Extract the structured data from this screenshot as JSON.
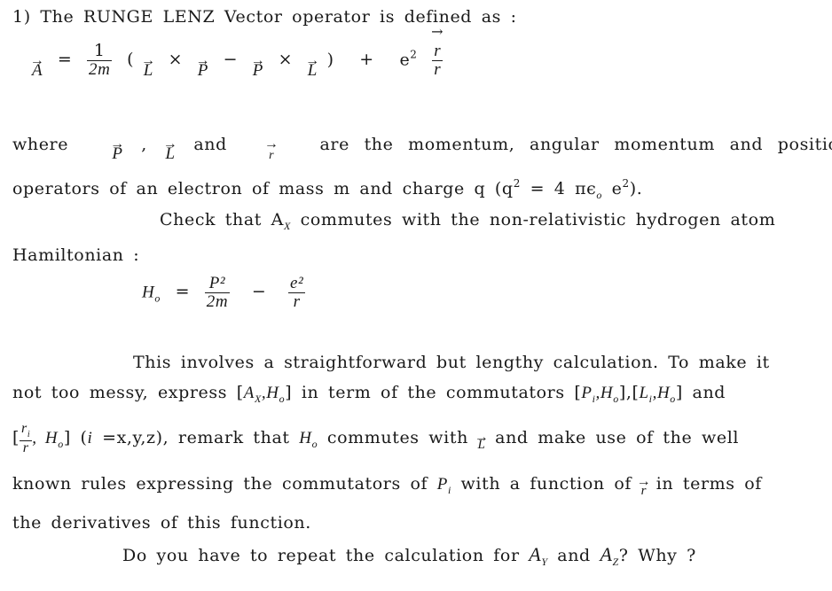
{
  "problem": {
    "number": "1)",
    "intro": "The RUNGE LENZ Vector operator is defined as :",
    "definition_formula": {
      "lhs": "A",
      "equals": "=",
      "coef_num": "1",
      "coef_den": "2m",
      "open_paren": "(",
      "term1_a": "L",
      "cross": "×",
      "term1_b": "P",
      "minus": "−",
      "term2_a": "P",
      "term2_b": "L",
      "close_paren": ")",
      "plus": "+",
      "e": "e",
      "e_exp": "2",
      "frac_num": "r",
      "frac_den": "r"
    },
    "where_line": {
      "where": "where",
      "v1": "P",
      "comma": ",",
      "v2": "L",
      "and": "and",
      "v3": "r",
      "rest": "are the momentum, angular momentum and position"
    },
    "operators_line": {
      "text": "operators of an electron of mass m and charge q (q",
      "q_exp": "2",
      "eq": " = 4 πϵ",
      "eps_sub": "o",
      "e": " e",
      "e_exp": "2",
      "close": ")."
    },
    "check_line": {
      "pre": "Check that A",
      "sub": "X",
      "post": " commutes with the non-relativistic hydrogen atom"
    },
    "hamiltonian_label": "Hamiltonian :",
    "hamiltonian_formula": {
      "H": "H",
      "H_sub": "o",
      "equals": "=",
      "num1": "P²",
      "den1": "2m",
      "minus": "−",
      "num2": "e²",
      "den2": "r"
    },
    "para2": {
      "line1": "This involves a straightforward but lengthy calculation. To make it",
      "line2_pre": "not too messy, express [",
      "line2_A": "A",
      "line2_A_sub": "X",
      "line2_H": ",H",
      "line2_H_sub": "o",
      "line2_mid": "] in term of the commutators [",
      "line2_P": "P",
      "line2_P_sub": "i",
      "line2_c1": ",H",
      "line2_c1_sub": "o",
      "line2_c2": "],[",
      "line2_L": "L",
      "line2_L_sub": "i",
      "line2_c3": ",H",
      "line2_c3_sub": "o",
      "line2_end": "] and",
      "line3_open": "[",
      "line3_num": "r",
      "line3_num_sub": "i",
      "line3_den": "r",
      "line3_H": ", H",
      "line3_H_sub": "o",
      "line3_close": "] (",
      "line3_i": "i",
      "line3_range": " =x,y,z), remark that ",
      "line3_H2": "H",
      "line3_H2_sub": "o",
      "line3_commutes": " commutes with ",
      "line3_L": "L",
      "line3_rest": " and make use of the well",
      "line4_pre": "known rules expressing the commutators of ",
      "line4_P": "P",
      "line4_P_sub": "i",
      "line4_mid": " with a function of ",
      "line4_r": "r",
      "line4_end": " in terms of",
      "line5": "the derivatives of this function."
    },
    "question": {
      "pre": "Do you have to repeat the calculation for ",
      "A1": "A",
      "A1_sub": "Y",
      "and": " and ",
      "A2": "A",
      "A2_sub": "Z",
      "post": "?  Why ?"
    }
  }
}
